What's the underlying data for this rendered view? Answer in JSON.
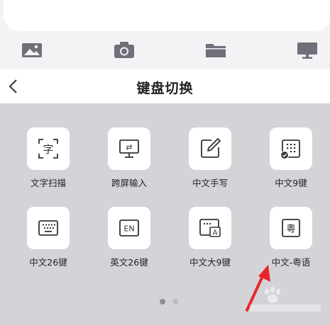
{
  "header": {
    "title": "键盘切换",
    "back_icon": "chevron-left-icon"
  },
  "toolbar": {
    "icons": [
      "image-icon",
      "camera-icon",
      "folder-icon",
      "monitor-icon"
    ]
  },
  "keyboards": [
    {
      "label": "文字扫描",
      "icon": "text-scan-icon",
      "glyph": "字"
    },
    {
      "label": "跨屏输入",
      "icon": "cross-screen-icon",
      "glyph": "⇄"
    },
    {
      "label": "中文手写",
      "icon": "handwriting-icon"
    },
    {
      "label": "中文9键",
      "icon": "nine-key-icon"
    },
    {
      "label": "中文26键",
      "icon": "twenty-six-key-icon"
    },
    {
      "label": "英文26键",
      "icon": "english-keyboard-icon",
      "glyph": "EN"
    },
    {
      "label": "中文大9键",
      "icon": "large-nine-key-icon",
      "glyph": "A"
    },
    {
      "label": "中文-粤语",
      "icon": "cantonese-icon",
      "glyph": "粵"
    }
  ],
  "pagination": {
    "total": 2,
    "current": 1
  },
  "colors": {
    "icon_gray": "#6f7079",
    "panel_bg": "#d3d4d8",
    "tile_bg": "#ffffff",
    "arrow": "#e8262a"
  }
}
